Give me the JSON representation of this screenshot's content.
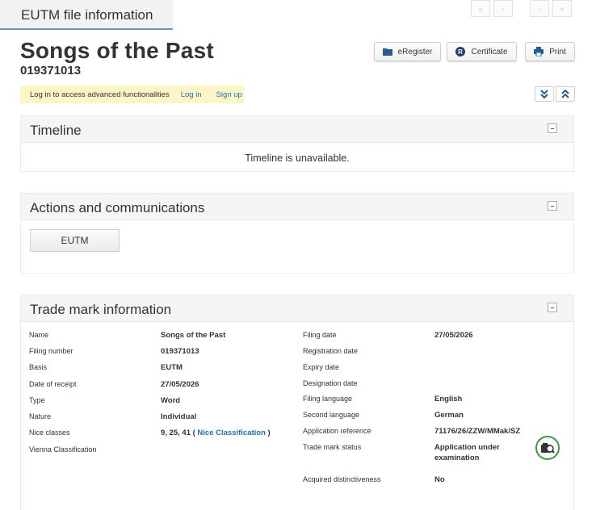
{
  "tab": {
    "title": "EUTM file information"
  },
  "pager": [
    "first-page-icon",
    "previous-page-icon",
    "next-page-icon",
    "last-page-icon"
  ],
  "mark": {
    "name": "Songs of the Past",
    "number": "019371013"
  },
  "toolbar": {
    "eregister": "eRegister",
    "certificate": "Certificate",
    "print": "Print"
  },
  "notice": {
    "text": "Log in to access advanced functionalities",
    "login": "Log in",
    "signup": "Sign up"
  },
  "timeline": {
    "title": "Timeline",
    "message": "Timeline is unavailable."
  },
  "actions": {
    "title": "Actions and communications",
    "button": "EUTM"
  },
  "trademark": {
    "title": "Trade mark information",
    "left": [
      {
        "label": "Name",
        "value": "Songs of the Past"
      },
      {
        "label": "Filing number",
        "value": "019371013"
      },
      {
        "label": "Basis",
        "value": "EUTM"
      },
      {
        "label": "Date of receipt",
        "value": "27/05/2026"
      },
      {
        "label": "Type",
        "value": "Word"
      },
      {
        "label": "Nature",
        "value": "Individual"
      },
      {
        "label": "Nice classes",
        "value": "9, 25, 41 ( ",
        "link": "Nice Classification",
        "suffix": " )"
      },
      {
        "label": "Vienna Classification",
        "value": ""
      }
    ],
    "right": [
      {
        "label": "Filing date",
        "value": "27/05/2026"
      },
      {
        "label": "Registration date",
        "value": ""
      },
      {
        "label": "Expiry date",
        "value": ""
      },
      {
        "label": "Designation date",
        "value": ""
      },
      {
        "label": "Filing language",
        "value": "English"
      },
      {
        "label": "Second language",
        "value": "German"
      },
      {
        "label": "Application reference",
        "value": "71176/26/ZZW/MMak/SZ"
      },
      {
        "label": "Trade mark status",
        "value": "Application under",
        "value2": "examination"
      },
      {
        "label": "Acquired distinctiveness",
        "value": "No"
      }
    ]
  },
  "colors": {
    "link": "#1f6fb3",
    "notice_bg": "#fbf6c5",
    "tab_underline": "#5a9bc8",
    "status_ring": "#3c9a3c"
  }
}
